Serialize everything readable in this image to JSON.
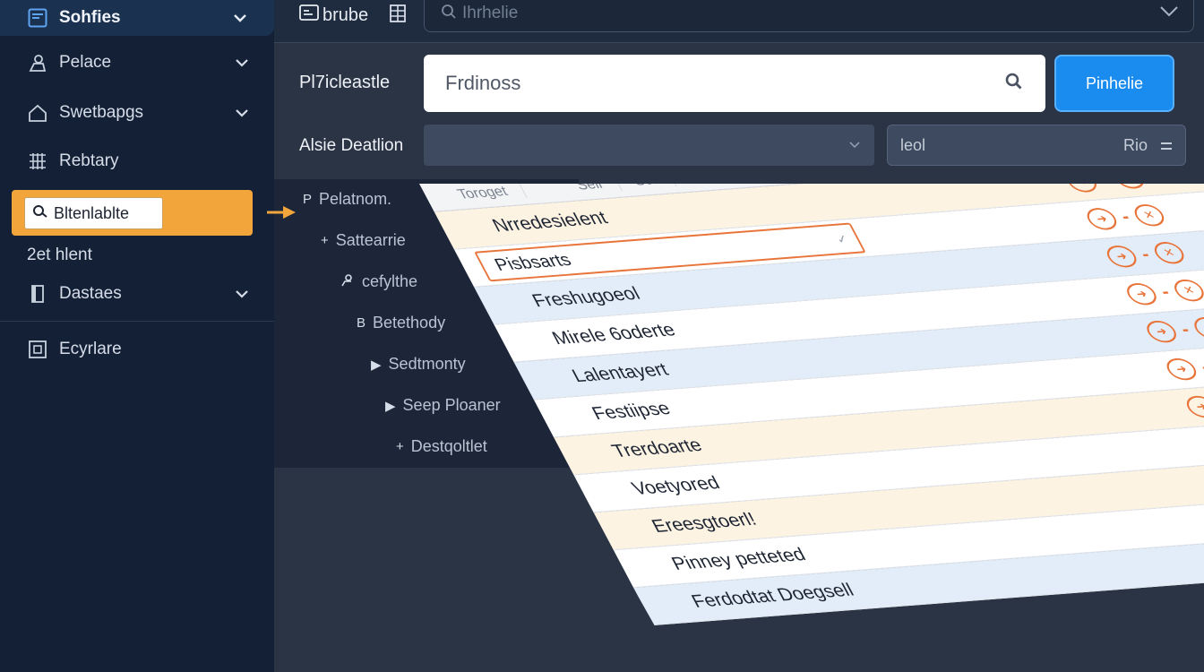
{
  "sidebar": {
    "header_title": "Sohfies",
    "items": [
      {
        "label": "Pelace",
        "icon": "user-pin-icon",
        "expandable": true
      },
      {
        "label": "Swetbapgs",
        "icon": "home-icon",
        "expandable": true
      },
      {
        "label": "Rebtary",
        "icon": "grid-icon",
        "expandable": false
      }
    ],
    "active_item": {
      "label": "Bltenlablte",
      "icon": "search-settings-icon"
    },
    "plain_item": "2et hlent",
    "items_after": [
      {
        "label": "Dastaes",
        "icon": "document-icon",
        "expandable": true
      }
    ],
    "footer_item": {
      "label": "Ecyrlare",
      "icon": "frame-icon"
    }
  },
  "topbar": {
    "brand": "brube",
    "search_placeholder": "Ihrhelie"
  },
  "form": {
    "main_label": "Pl7icleastle",
    "main_value": "Frdinoss",
    "primary_button": "Pinhelie",
    "select_label": "Alsie Deatlion",
    "filter_left": "leol",
    "filter_right": "Rio"
  },
  "tree": [
    {
      "label": "Pelatnom.",
      "marker": "P"
    },
    {
      "label": "Sattearrie",
      "marker": "+"
    },
    {
      "label": "cefylthe",
      "marker": "person"
    },
    {
      "label": "Betethody",
      "marker": "B"
    },
    {
      "label": "Sedtmonty",
      "marker": "▶"
    },
    {
      "label": "Seep Ploaner",
      "marker": "▶"
    },
    {
      "label": "Destqoltlet",
      "marker": "+"
    }
  ],
  "table": {
    "headers": [
      "Toroget",
      "Sell",
      "Set"
    ],
    "edit_row_value": "Pisbsarts",
    "rows": [
      {
        "name": "Nrredesielent",
        "tone": "cream"
      },
      {
        "name": "Freshugoeol",
        "tone": "blue"
      },
      {
        "name": "Mirele 6oderte",
        "tone": "white"
      },
      {
        "name": "Lalentayert",
        "tone": "blue"
      },
      {
        "name": "Festiipse",
        "tone": "white"
      },
      {
        "name": "Trerdoarte",
        "tone": "cream"
      },
      {
        "name": "Voetyored",
        "tone": "white"
      },
      {
        "name": "Ereesgtoerl!",
        "tone": "cream"
      },
      {
        "name": "Pinney petteted",
        "tone": "white"
      },
      {
        "name": "Ferdodtat Doegsell",
        "tone": "blue"
      }
    ]
  },
  "colors": {
    "accent_orange": "#f2a53a",
    "primary_blue": "#1a8cf0",
    "action_orange": "#e8743a",
    "sidebar_bg": "#132036"
  }
}
